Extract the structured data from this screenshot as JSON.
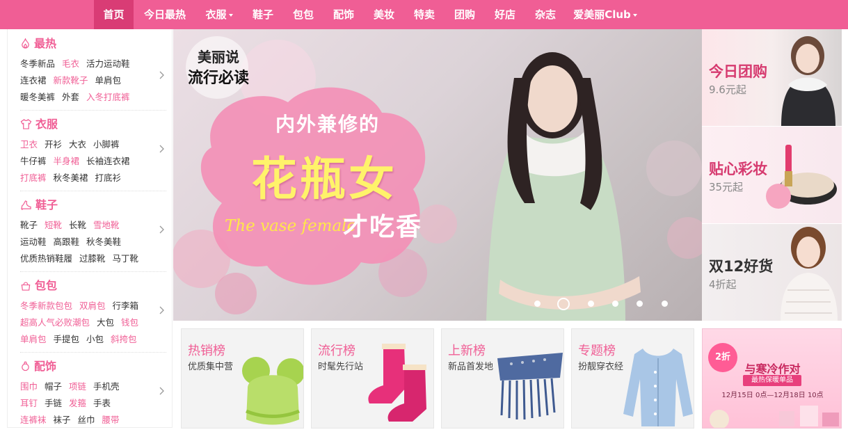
{
  "nav": {
    "items": [
      {
        "label": "首页",
        "active": true
      },
      {
        "label": "今日最热"
      },
      {
        "label": "衣服",
        "dropdown": true
      },
      {
        "label": "鞋子"
      },
      {
        "label": "包包"
      },
      {
        "label": "配饰"
      },
      {
        "label": "美妆"
      },
      {
        "label": "特卖"
      },
      {
        "label": "团购"
      },
      {
        "label": "好店"
      },
      {
        "label": "杂志"
      },
      {
        "label": "爱美丽Club",
        "dropdown": true
      }
    ]
  },
  "categories": [
    {
      "title": "最热",
      "icon": "flame-icon",
      "rows": [
        [
          "冬季新品",
          "毛衣",
          "活力运动鞋"
        ],
        [
          "连衣裙",
          "新款靴子",
          "单肩包"
        ],
        [
          "暖冬美裤",
          "外套",
          "入冬打底裤"
        ]
      ],
      "pink": [
        [
          1
        ],
        [
          1
        ],
        [
          2
        ]
      ]
    },
    {
      "title": "衣服",
      "icon": "shirt-icon",
      "rows": [
        [
          "卫衣",
          "开衫",
          "大衣",
          "小脚裤"
        ],
        [
          "牛仔裤",
          "半身裙",
          "长袖连衣裙"
        ],
        [
          "打底裤",
          "秋冬美裙",
          "打底衫"
        ]
      ],
      "pink": [
        [
          0
        ],
        [
          1
        ],
        [
          0
        ]
      ]
    },
    {
      "title": "鞋子",
      "icon": "shoe-icon",
      "rows": [
        [
          "靴子",
          "短靴",
          "长靴",
          "雪地靴"
        ],
        [
          "运动鞋",
          "高跟鞋",
          "秋冬美鞋"
        ],
        [
          "优质热销鞋履",
          "过膝靴",
          "马丁靴"
        ]
      ],
      "pink": [
        [
          1,
          3
        ],
        [],
        []
      ]
    },
    {
      "title": "包包",
      "icon": "bag-icon",
      "rows": [
        [
          "冬季新款包包",
          "双肩包",
          "行李箱"
        ],
        [
          "超高人气必败潮包",
          "大包",
          "钱包"
        ],
        [
          "单肩包",
          "手提包",
          "小包",
          "斜挎包"
        ]
      ],
      "pink": [
        [
          0,
          1
        ],
        [
          0,
          2
        ],
        [
          0,
          3
        ]
      ]
    },
    {
      "title": "配饰",
      "icon": "ring-icon",
      "rows": [
        [
          "围巾",
          "帽子",
          "项链",
          "手机壳"
        ],
        [
          "耳钉",
          "手链",
          "发箍",
          "手表"
        ],
        [
          "连裤袜",
          "袜子",
          "丝巾",
          "腰带"
        ]
      ],
      "pink": [
        [
          0,
          2
        ],
        [
          0,
          2
        ],
        [
          0,
          3
        ]
      ]
    }
  ],
  "banner": {
    "badge_top": "美丽说",
    "badge_bottom": "流行必读",
    "line1": "内外兼修的",
    "line2": "花瓶女",
    "line3": "才吃香",
    "line4": "The vase female",
    "slide_count": 6,
    "active_slide": 1
  },
  "promos": [
    {
      "title": "今日团购",
      "sub": "9.6元起",
      "image": "model-in-black-coat"
    },
    {
      "title": "贴心彩妆",
      "sub": "35元起",
      "image": "cosmetics"
    },
    {
      "title": "双12好货",
      "sub": "4折起",
      "image": "model-in-white-jacket"
    }
  ],
  "cards": [
    {
      "title": "热销榜",
      "sub": "优质集中营",
      "image": "green-knit-hat"
    },
    {
      "title": "流行榜",
      "sub": "时髦先行站",
      "image": "pink-snow-boots"
    },
    {
      "title": "上新榜",
      "sub": "新品首发地",
      "image": "blue-fringe-bag"
    },
    {
      "title": "专题榜",
      "sub": "扮靓穿衣经",
      "image": "blue-cardigan"
    }
  ],
  "pink_card": {
    "badge": "2折",
    "title": "与寒冷作对",
    "ribbon": "最热保暖单品",
    "date": "12月15日 0点—12月18日 10点"
  },
  "colors": {
    "accent": "#f05e95",
    "accent_dark": "#d93c75",
    "promo_title": "#d63a6f"
  }
}
